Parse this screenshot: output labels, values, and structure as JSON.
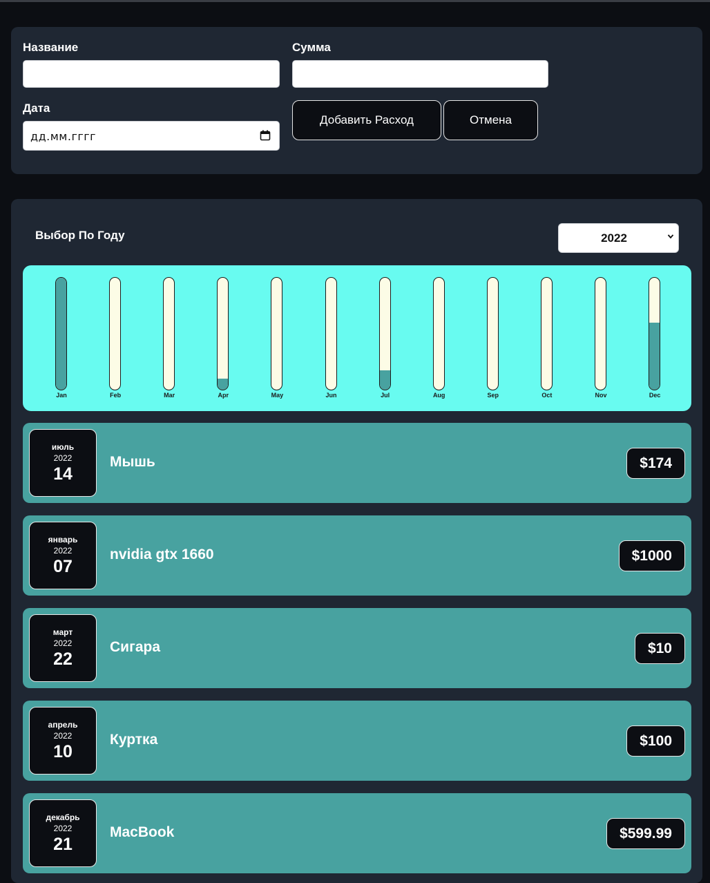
{
  "form": {
    "name_label": "Название",
    "amount_label": "Сумма",
    "date_label": "Дата",
    "date_placeholder": "дд.мм.гггг",
    "name_value": "",
    "amount_value": "",
    "add_button": "Добавить Расход",
    "cancel_button": "Отмена"
  },
  "filter": {
    "label": "Выбор По Году",
    "selected_year": "2022"
  },
  "chart_data": {
    "type": "bar",
    "categories": [
      "Jan",
      "Feb",
      "Mar",
      "Apr",
      "May",
      "Jun",
      "Jul",
      "Aug",
      "Sep",
      "Oct",
      "Nov",
      "Dec"
    ],
    "values": [
      1000,
      0,
      0,
      100,
      0,
      0,
      174,
      0,
      0,
      0,
      0,
      599.99
    ],
    "ylim": [
      0,
      1000
    ]
  },
  "expenses": [
    {
      "month": "июль",
      "year": "2022",
      "day": "14",
      "title": "Мышь",
      "amount": "$174"
    },
    {
      "month": "январь",
      "year": "2022",
      "day": "07",
      "title": "nvidia gtx 1660",
      "amount": "$1000"
    },
    {
      "month": "март",
      "year": "2022",
      "day": "22",
      "title": "Сигара",
      "amount": "$10"
    },
    {
      "month": "апрель",
      "year": "2022",
      "day": "10",
      "title": "Куртка",
      "amount": "$100"
    },
    {
      "month": "декабрь",
      "year": "2022",
      "day": "21",
      "title": "MacBook",
      "amount": "$599.99"
    }
  ],
  "colors": {
    "page_bg": "#0c0e13",
    "panel_bg": "#1f2733",
    "chart_bg": "#68fbf0",
    "item_bg": "#48a2a0",
    "bar_fill": "#48a2a0",
    "bar_empty": "#fcfce6"
  },
  "icons": {
    "date_input": "calendar-icon",
    "year_select": "chevron-down-icon"
  }
}
